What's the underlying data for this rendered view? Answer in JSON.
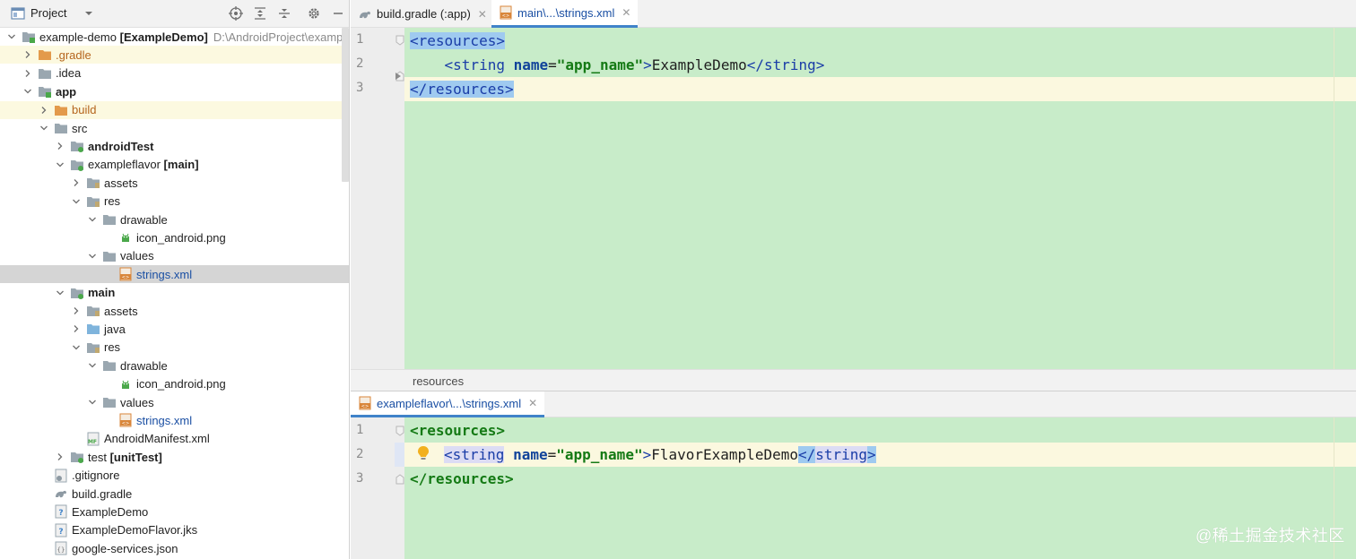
{
  "project_panel": {
    "title": "Project",
    "toolbar_icons": [
      "locate-icon",
      "expand-all-icon",
      "collapse-all-icon",
      "settings-icon",
      "minimize-icon"
    ]
  },
  "tree": [
    {
      "label": "example-demo [ExampleDemo]",
      "path": "D:\\AndroidProject\\examp",
      "icon": "module-folder",
      "expanded": true
    },
    {
      "label": ".gradle",
      "icon": "folder-orange",
      "expanded": false
    },
    {
      "label": ".idea",
      "icon": "folder-gray",
      "expanded": false
    },
    {
      "label": "app",
      "icon": "module-folder",
      "expanded": true
    },
    {
      "label": "build",
      "icon": "folder-orange",
      "expanded": false
    },
    {
      "label": "src",
      "icon": "folder-gray",
      "expanded": true
    },
    {
      "label": "androidTest",
      "icon": "source-set-folder",
      "expanded": false
    },
    {
      "label": "exampleflavor [main]",
      "icon": "source-set-folder",
      "expanded": true
    },
    {
      "label": "assets",
      "icon": "resources-folder",
      "expanded": false
    },
    {
      "label": "res",
      "icon": "resources-folder",
      "expanded": true
    },
    {
      "label": "drawable",
      "icon": "folder-gray",
      "expanded": true
    },
    {
      "label": "icon_android.png",
      "icon": "android-image"
    },
    {
      "label": "values",
      "icon": "folder-gray",
      "expanded": true
    },
    {
      "label": "strings.xml",
      "icon": "xml-file"
    },
    {
      "label": "main",
      "icon": "source-set-folder",
      "expanded": true
    },
    {
      "label": "assets",
      "icon": "resources-folder",
      "expanded": false
    },
    {
      "label": "java",
      "icon": "source-folder-blue",
      "expanded": false
    },
    {
      "label": "res",
      "icon": "resources-folder",
      "expanded": true
    },
    {
      "label": "drawable",
      "icon": "folder-gray",
      "expanded": true
    },
    {
      "label": "icon_android.png",
      "icon": "android-image"
    },
    {
      "label": "values",
      "icon": "folder-gray",
      "expanded": true
    },
    {
      "label": "strings.xml",
      "icon": "xml-file"
    },
    {
      "label": "AndroidManifest.xml",
      "icon": "manifest-file"
    },
    {
      "label": "test [unitTest]",
      "icon": "source-set-folder",
      "expanded": false
    },
    {
      "label": ".gitignore",
      "icon": "gitignore-file"
    },
    {
      "label": "build.gradle",
      "icon": "gradle-file"
    },
    {
      "label": "ExampleDemo",
      "icon": "unknown-file"
    },
    {
      "label": "ExampleDemoFlavor.jks",
      "icon": "unknown-file"
    },
    {
      "label": "google-services.json",
      "icon": "json-file"
    }
  ],
  "top_editor": {
    "tabs": [
      {
        "label": "build.gradle (:app)",
        "icon": "gradle-icon"
      },
      {
        "label": "main\\...\\strings.xml",
        "icon": "xml-icon"
      }
    ],
    "line_numbers": [
      "1",
      "2",
      "3"
    ],
    "code": {
      "l1": "<resources>",
      "l2_indent": "    ",
      "l2_open": "<string",
      "l2_attr": "name",
      "l2_eq": "=",
      "l2_val": "\"app_name\"",
      "l2_gt": ">",
      "l2_text": "ExampleDemo",
      "l2_close": "</string>",
      "l3": "</resources>"
    },
    "breadcrumb": "resources"
  },
  "bottom_editor": {
    "tabs": [
      {
        "label": "exampleflavor\\...\\strings.xml",
        "icon": "xml-icon"
      }
    ],
    "line_numbers": [
      "1",
      "2",
      "3"
    ],
    "code": {
      "l1": "<resources>",
      "l2_open": "<string",
      "l2_attr": "name",
      "l2_eq": "=",
      "l2_val": "\"app_name\"",
      "l2_gt": ">",
      "l2_text": "FlavorExampleDemo",
      "l2_close_lt": "</",
      "l2_close_name": "string",
      "l2_close_gt": ">",
      "l3": "</resources>"
    }
  },
  "watermark": "@稀土掘金技术社区",
  "colors": {
    "editor_bg": "#c8ecc9",
    "current_line": "#fbf8df",
    "selection": "#d5d5d5",
    "tab_accent": "#4083c9"
  }
}
